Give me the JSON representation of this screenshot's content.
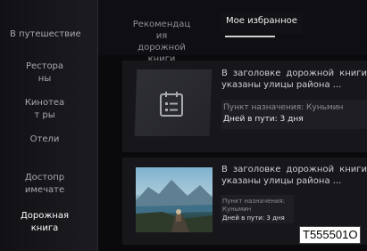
{
  "sidebar": {
    "items": [
      {
        "label": "В путешествие"
      },
      {
        "label": "Ресторa ны"
      },
      {
        "label": "Кинотеат ры"
      },
      {
        "label": "Отели"
      },
      {
        "label": "Достопр имечате"
      },
      {
        "label": "Дорожная книга"
      }
    ]
  },
  "tabs": {
    "recommendations": "Рекомендац ия дорожной книги",
    "favorites": "Мое избранное"
  },
  "cards": [
    {
      "title": "В заголовке дорожной книги указаны улицы района ...",
      "destination": "Пункт назначения: Куньмин",
      "days": "Дней в пути: 3 дня",
      "image": "notes-icon"
    },
    {
      "title": "В заголовке дорожной книги указаны улицы района ...",
      "destination": "Пункт назначения: Куньмин",
      "days": "Дней в пути: 3 дня",
      "image": "landscape-photo"
    }
  ],
  "watermark": "T555501O",
  "colors": {
    "background": "#0a0a0d",
    "sidebar": "#1b1b21",
    "card": "#16161b",
    "active_text": "#ffffff"
  }
}
